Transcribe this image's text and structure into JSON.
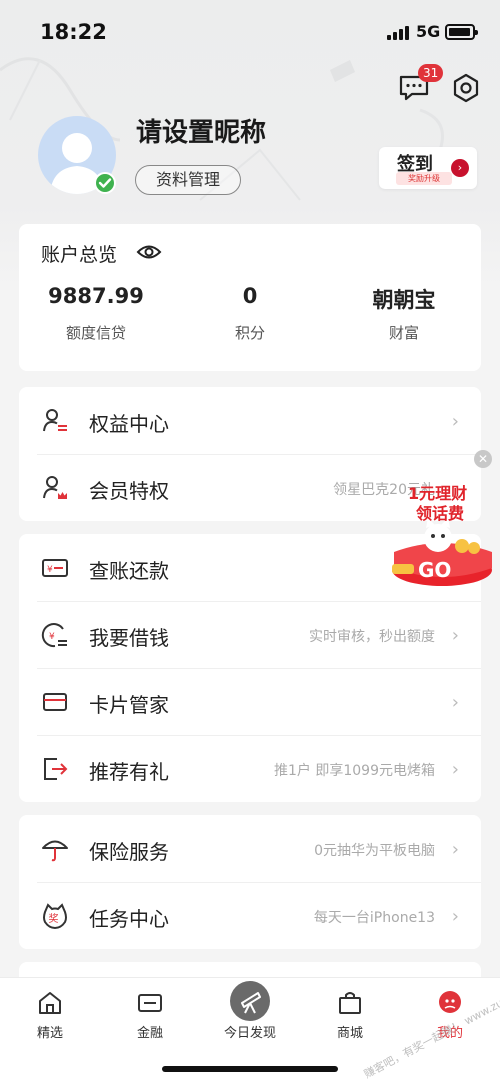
{
  "status_bar": {
    "time": "18:22",
    "network": "5G"
  },
  "header": {
    "message_badge": "31"
  },
  "profile": {
    "nickname": "请设置昵称",
    "manage_label": "资料管理",
    "checkin_label": "签到",
    "checkin_sub": "奖励升级"
  },
  "account": {
    "title": "账户总览",
    "stats": [
      {
        "value": "9887.99",
        "label": "额度信贷"
      },
      {
        "value": "0",
        "label": "积分"
      },
      {
        "value": "朝朝宝",
        "label": "财富"
      }
    ]
  },
  "menu_group_1": [
    {
      "label": "权益中心",
      "hint": "",
      "icon": "benefit-center-icon"
    },
    {
      "label": "会员特权",
      "hint": "领星巴克20元礼",
      "icon": "member-privilege-icon"
    }
  ],
  "menu_group_2": [
    {
      "label": "查账还款",
      "hint": "",
      "icon": "bill-repay-icon"
    },
    {
      "label": "我要借钱",
      "hint": "实时审核，秒出额度",
      "icon": "borrow-icon"
    },
    {
      "label": "卡片管家",
      "hint": "",
      "icon": "card-manager-icon"
    },
    {
      "label": "推荐有礼",
      "hint": "推1户 即享1099元电烤箱",
      "icon": "referral-icon"
    }
  ],
  "menu_group_3": [
    {
      "label": "保险服务",
      "hint": "0元抽华为平板电脑",
      "icon": "umbrella-icon"
    },
    {
      "label": "任务中心",
      "hint": "每天一台iPhone13",
      "icon": "task-reward-icon"
    }
  ],
  "promo": {
    "line1": "1元理财",
    "line2": "领话费",
    "go": "GO"
  },
  "tabbar": [
    {
      "label": "精选",
      "icon": "home-icon"
    },
    {
      "label": "金融",
      "icon": "finance-icon"
    },
    {
      "label": "今日发现",
      "icon": "telescope-icon"
    },
    {
      "label": "商城",
      "icon": "shopping-bag-icon"
    },
    {
      "label": "我的",
      "icon": "my-profile-icon"
    }
  ],
  "watermark": "赚客吧，有奖一起赚！ www.zuanke8.com",
  "colors": {
    "accent": "#e0333a",
    "checkin_arrow": "#c8112d",
    "verified": "#3fb24f"
  }
}
